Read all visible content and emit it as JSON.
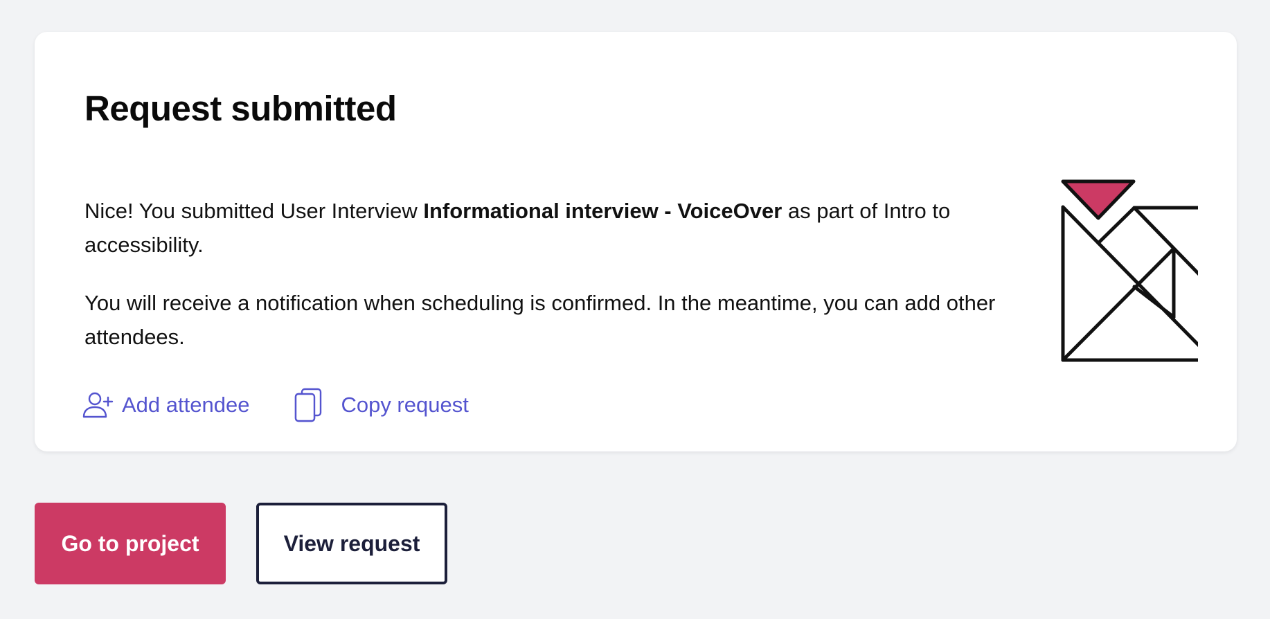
{
  "card": {
    "title": "Request submitted",
    "paragraph1": {
      "prefix": "Nice! You submitted User Interview ",
      "highlight": "Informational interview - VoiceOver",
      "suffix": " as part of Intro to accessibility."
    },
    "paragraph2": "You will receive a notification when scheduling is confirmed. In the meantime, you can add other attendees.",
    "actions": {
      "add_attendee": {
        "label": "Add attendee",
        "icon": "add-user-icon"
      },
      "copy_request": {
        "label": "Copy request",
        "icon": "copy-icon"
      }
    },
    "illustration": {
      "name": "tangram-envelope-illustration",
      "accent_color": "#cc3a64"
    }
  },
  "footer": {
    "primary_button": "Go to project",
    "secondary_button": "View request"
  },
  "colors": {
    "link": "#5454cf",
    "primary": "#cc3a64",
    "dark": "#1c1f3a",
    "background": "#f2f3f5"
  }
}
